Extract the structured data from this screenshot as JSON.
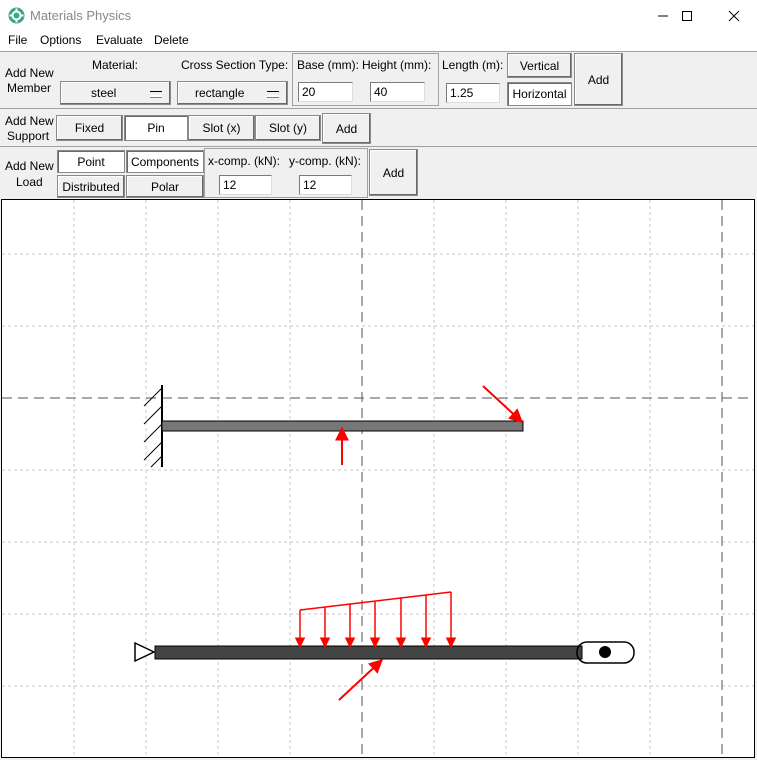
{
  "window": {
    "title": "Materials Physics"
  },
  "menu": [
    "File",
    "Options",
    "Evaluate",
    "Delete"
  ],
  "member": {
    "section_label_1": "Add New",
    "section_label_2": "Member",
    "material_label": "Material:",
    "material_value": "steel",
    "cross_section_label": "Cross Section Type:",
    "cross_section_value": "rectangle",
    "base_label": "Base (mm):",
    "base_value": "20",
    "height_label": "Height (mm):",
    "height_value": "40",
    "length_label": "Length (m):",
    "length_value": "1.25",
    "vertical_label": "Vertical",
    "horizontal_label": "Horizontal",
    "add_label": "Add"
  },
  "support": {
    "section_label_1": "Add New",
    "section_label_2": "Support",
    "fixed_label": "Fixed",
    "pin_label": "Pin",
    "slot_x_label": "Slot (x)",
    "slot_y_label": "Slot (y)",
    "add_label": "Add"
  },
  "load": {
    "section_label_1": "Add New",
    "section_label_2": "Load",
    "point_label": "Point",
    "distributed_label": "Distributed",
    "components_label": "Components",
    "polar_label": "Polar",
    "x_comp_label": "x-comp. (kN):",
    "x_comp_value": "12",
    "y_comp_label": "y-comp. (kN):",
    "y_comp_value": "12",
    "add_label": "Add"
  },
  "icons": {
    "app": "gear-icon",
    "minimize": "minimize-icon",
    "maximize": "maximize-icon",
    "close": "close-icon"
  },
  "colors": {
    "load_arrow": "#ff0000",
    "member": "#555555",
    "grid": "#c8c8c8"
  }
}
